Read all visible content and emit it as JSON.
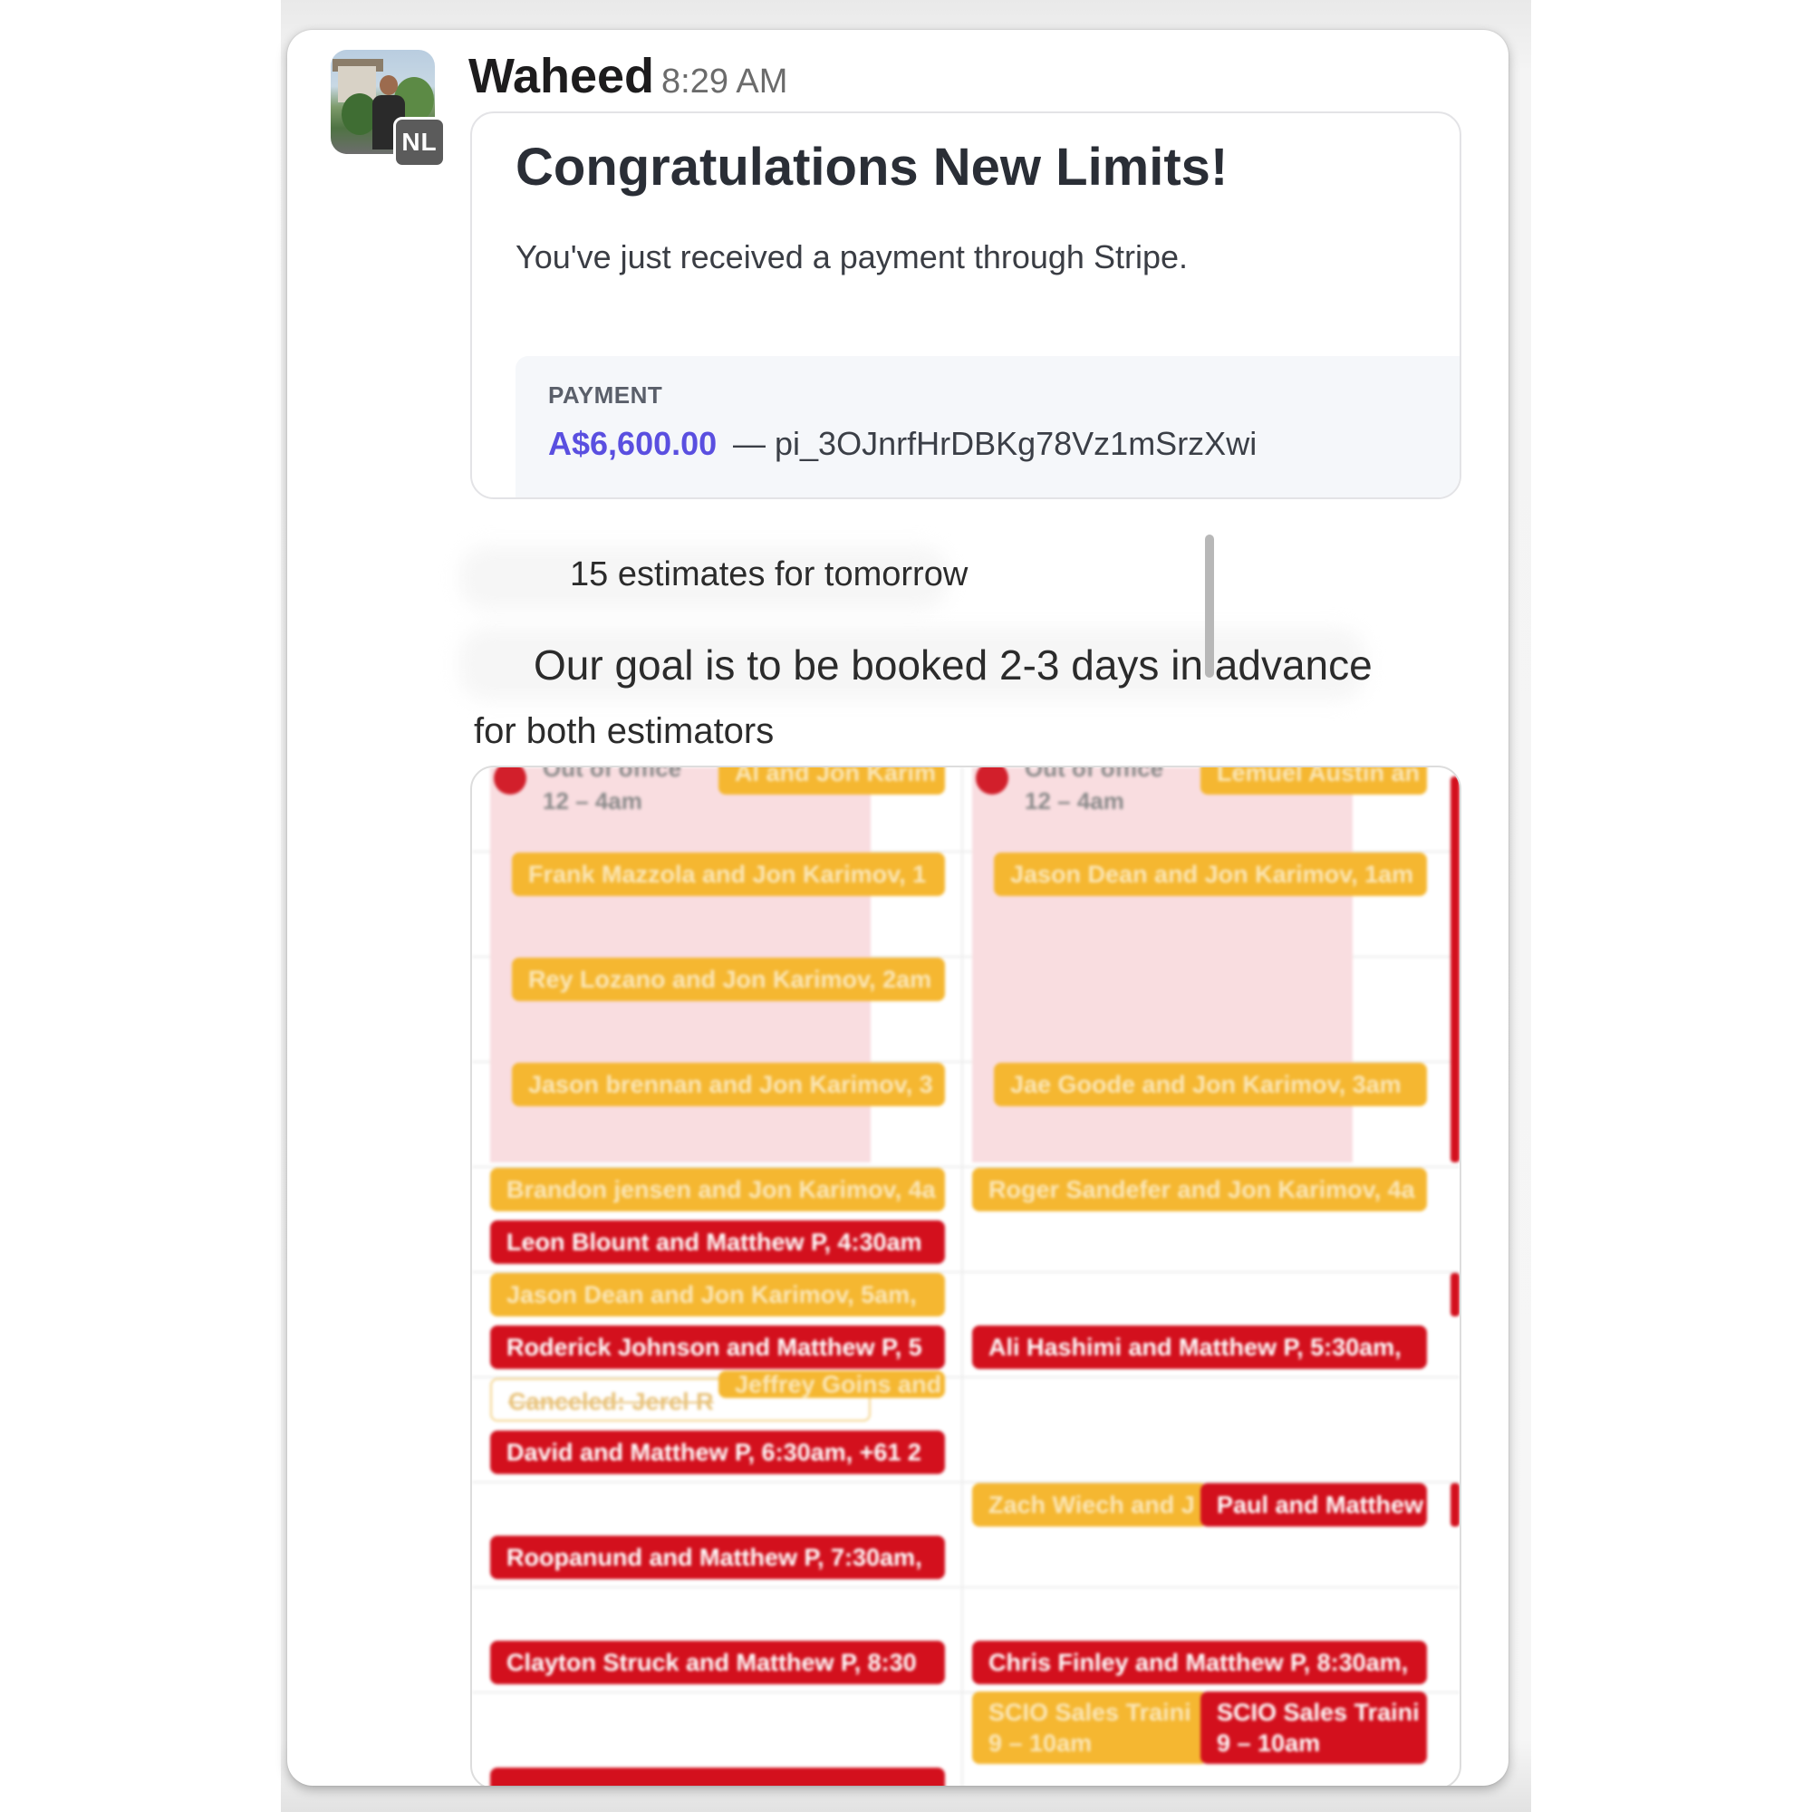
{
  "message": {
    "sender": "Waheed",
    "time": "8:29 AM",
    "avatar_badge": "NL"
  },
  "stripe_card": {
    "title": "Congratulations New Limits!",
    "subtitle": "You've just received a payment through Stripe.",
    "payment_label": "PAYMENT",
    "amount": "A$6,600.00",
    "separator": "—",
    "payment_id": "pi_3OJnrfHrDBKg78Vz1mSrzXwi",
    "amount_color": "#5a4fe0"
  },
  "text_lines": {
    "estimates": "15 estimates for tomorrow",
    "goal": "Our goal is to be booked 2-3 days in advance",
    "goal_cont": "for both  estimators"
  },
  "calendar": {
    "colors": {
      "yellow": "#f5b731",
      "red": "#d3101d",
      "out_of_office": "#f9dde0"
    },
    "left_column": {
      "ooo_title": "Out of office",
      "ooo_time": "12 – 4am",
      "events": [
        {
          "label": "Al and Jon Karim",
          "color": "yellow"
        },
        {
          "label": "Frank Mazzola and Jon Karimov, 1",
          "color": "yellow"
        },
        {
          "label": "Rey Lozano and Jon Karimov, 2am",
          "color": "yellow"
        },
        {
          "label": "Jason brennan and Jon Karimov, 3",
          "color": "yellow"
        },
        {
          "label": "Brandon jensen and Jon Karimov, 4a",
          "color": "yellow"
        },
        {
          "label": "Leon Blount and Matthew P, 4:30am",
          "color": "red"
        },
        {
          "label": "Jason Dean and Jon Karimov, 5am,",
          "color": "yellow"
        },
        {
          "label": "Roderick Johnson and Matthew P, 5",
          "color": "red"
        },
        {
          "label": "Canceled: Jerel R",
          "color": "canceled"
        },
        {
          "label": "Jeffrey Goins and",
          "color": "yellow"
        },
        {
          "label": "David and Matthew P, 6:30am, +61 2",
          "color": "red"
        },
        {
          "label": "Roopanund and Matthew P, 7:30am,",
          "color": "red"
        },
        {
          "label": "Clayton Struck and Matthew P, 8:30",
          "color": "red"
        }
      ]
    },
    "right_column": {
      "ooo_title": "Out of office",
      "ooo_time": "12 – 4am",
      "events": [
        {
          "label": "Lemuel Austin an",
          "color": "yellow"
        },
        {
          "label": "Jason Dean and Jon Karimov, 1am",
          "color": "yellow"
        },
        {
          "label": "Jae Goode and Jon Karimov, 3am",
          "color": "yellow"
        },
        {
          "label": "Roger Sandefer and Jon Karimov, 4a",
          "color": "yellow"
        },
        {
          "label": "Ali Hashimi and Matthew P, 5:30am,",
          "color": "red"
        },
        {
          "label": "Zach Wiech and J",
          "color": "yellow"
        },
        {
          "label": "Paul and Matthew",
          "color": "red"
        },
        {
          "label": "Chris Finley and Matthew P, 8:30am,",
          "color": "red"
        },
        {
          "label": "SCIO Sales Traini",
          "sub": "9 – 10am",
          "color": "yellow"
        },
        {
          "label": "SCIO Sales Traini",
          "sub": "9 – 10am",
          "color": "red"
        }
      ]
    }
  }
}
